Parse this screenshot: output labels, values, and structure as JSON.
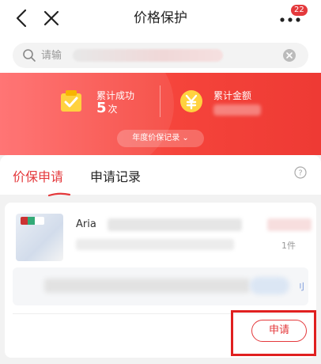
{
  "header": {
    "title": "价格保护",
    "badge_count": "22"
  },
  "search": {
    "placeholder": "请输"
  },
  "stats": {
    "success_label": "累计成功",
    "success_value": "5",
    "success_unit": "次",
    "amount_label": "累计金额",
    "year_record_label": "年度价保记录 ⌄"
  },
  "tabs": [
    {
      "label": "价保申请",
      "active": true
    },
    {
      "label": "申请记录",
      "active": false
    }
  ],
  "product": {
    "title_visible_prefix": "Aria",
    "qty_suffix": "1件"
  },
  "info_bar": {
    "link_fragment": "刂"
  },
  "actions": {
    "apply_label": "申请"
  },
  "colors": {
    "accent": "#e4393c",
    "banner_start": "#ff6a6a",
    "banner_end": "#ee3a34",
    "highlight": "#e02020"
  }
}
